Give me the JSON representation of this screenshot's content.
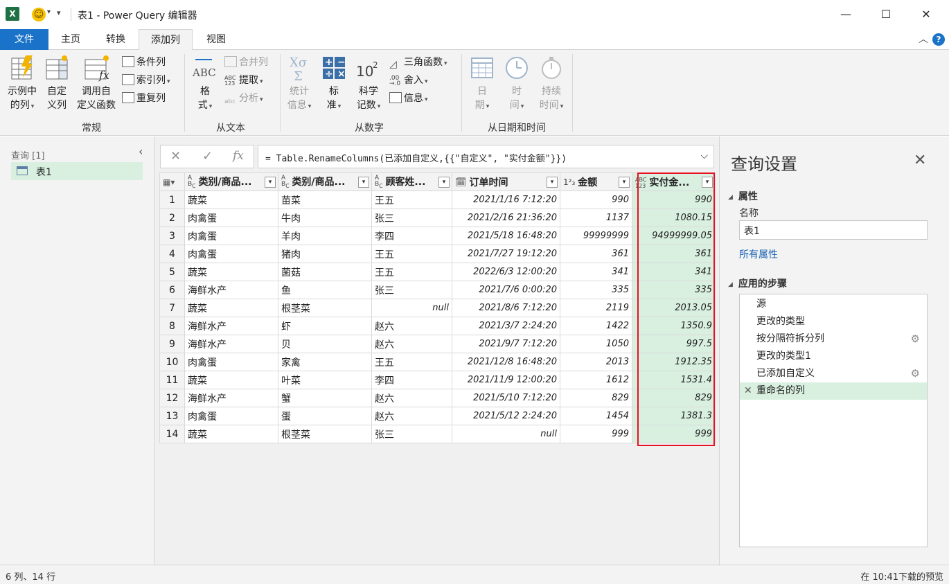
{
  "titlebar": {
    "title": "表1 - Power Query 编辑器",
    "minimize": "—",
    "maximize": "☐",
    "close": "✕",
    "app_letter": "X"
  },
  "tabs": [
    {
      "label": "文件"
    },
    {
      "label": "主页"
    },
    {
      "label": "转换"
    },
    {
      "label": "添加列"
    },
    {
      "label": "视图"
    }
  ],
  "ribbon": {
    "groups": {
      "general": "常规",
      "from_text": "从文本",
      "from_number": "从数字",
      "from_datetime": "从日期和时间"
    },
    "example_col": [
      "示例中",
      "的列"
    ],
    "custom_col": [
      "自定",
      "义列"
    ],
    "invoke_func": [
      "调用自",
      "定义函数"
    ],
    "conditional_col": "条件列",
    "index_col": "索引列",
    "duplicate_col": "重复列",
    "format": [
      "格",
      "式"
    ],
    "merge_cols": "合并列",
    "extract": "提取",
    "parse": "分析",
    "statistics": [
      "统计",
      "信息"
    ],
    "standard": [
      "标",
      "准"
    ],
    "scientific": [
      "科学",
      "记数"
    ],
    "trig": "三角函数",
    "rounding": "舍入",
    "information": "信息",
    "date": [
      "日",
      "期"
    ],
    "time": [
      "时",
      "间"
    ],
    "duration": [
      "持续",
      "时间"
    ]
  },
  "left_pane": {
    "header": "查询 [1]",
    "query": "表1"
  },
  "formula": {
    "cancel": "✕",
    "confirm": "✓",
    "fx": "fx",
    "text": "= Table.RenameColumns(已添加自定义,{{\"自定义\", \"实付金额\"}})"
  },
  "grid": {
    "columns": [
      {
        "type": "ABC",
        "name": "类别/商品..."
      },
      {
        "type": "ABC",
        "name": "类别/商品..."
      },
      {
        "type": "ABC",
        "name": "顾客姓..."
      },
      {
        "type": "date",
        "name": "订单时间"
      },
      {
        "type": "123",
        "name": "金额"
      },
      {
        "type": "ABC123",
        "name": "实付金..."
      }
    ],
    "rows": [
      [
        "1",
        "蔬菜",
        "苗菜",
        "王五",
        "2021/1/16 7:12:20",
        "990",
        "990"
      ],
      [
        "2",
        "肉禽蛋",
        "牛肉",
        "张三",
        "2021/2/16 21:36:20",
        "1137",
        "1080.15"
      ],
      [
        "3",
        "肉禽蛋",
        "羊肉",
        "李四",
        "2021/5/18 16:48:20",
        "99999999",
        "94999999.05"
      ],
      [
        "4",
        "肉禽蛋",
        "猪肉",
        "王五",
        "2021/7/27 19:12:20",
        "361",
        "361"
      ],
      [
        "5",
        "蔬菜",
        "菌菇",
        "王五",
        "2022/6/3 12:00:20",
        "341",
        "341"
      ],
      [
        "6",
        "海鲜水产",
        "鱼",
        "张三",
        "2021/7/6 0:00:20",
        "335",
        "335"
      ],
      [
        "7",
        "蔬菜",
        "根茎菜",
        "null",
        "2021/8/6 7:12:20",
        "2119",
        "2013.05"
      ],
      [
        "8",
        "海鲜水产",
        "虾",
        "赵六",
        "2021/3/7 2:24:20",
        "1422",
        "1350.9"
      ],
      [
        "9",
        "海鲜水产",
        "贝",
        "赵六",
        "2021/9/7 7:12:20",
        "1050",
        "997.5"
      ],
      [
        "10",
        "肉禽蛋",
        "家禽",
        "王五",
        "2021/12/8 16:48:20",
        "2013",
        "1912.35"
      ],
      [
        "11",
        "蔬菜",
        "叶菜",
        "李四",
        "2021/11/9 12:00:20",
        "1612",
        "1531.4"
      ],
      [
        "12",
        "海鲜水产",
        "蟹",
        "赵六",
        "2021/5/10 7:12:20",
        "829",
        "829"
      ],
      [
        "13",
        "肉禽蛋",
        "蛋",
        "赵六",
        "2021/5/12 2:24:20",
        "1454",
        "1381.3"
      ],
      [
        "14",
        "蔬菜",
        "根茎菜",
        "张三",
        "null",
        "999",
        "999"
      ]
    ]
  },
  "right_pane": {
    "title": "查询设置",
    "close": "✕",
    "props_header": "属性",
    "name_label": "名称",
    "name_value": "表1",
    "all_props": "所有属性",
    "steps_header": "应用的步骤",
    "steps": [
      {
        "label": "源",
        "gear": false
      },
      {
        "label": "更改的类型",
        "gear": false
      },
      {
        "label": "按分隔符拆分列",
        "gear": true
      },
      {
        "label": "更改的类型1",
        "gear": false
      },
      {
        "label": "已添加自定义",
        "gear": true
      },
      {
        "label": "重命名的列",
        "gear": false,
        "selected": true
      }
    ]
  },
  "status": {
    "left": "6 列、14 行",
    "right": "在 10:41下载的预览"
  },
  "colors": {
    "accent": "#1a73c8",
    "selection": "#d9f0e1",
    "highlight_border": "#e81123"
  }
}
